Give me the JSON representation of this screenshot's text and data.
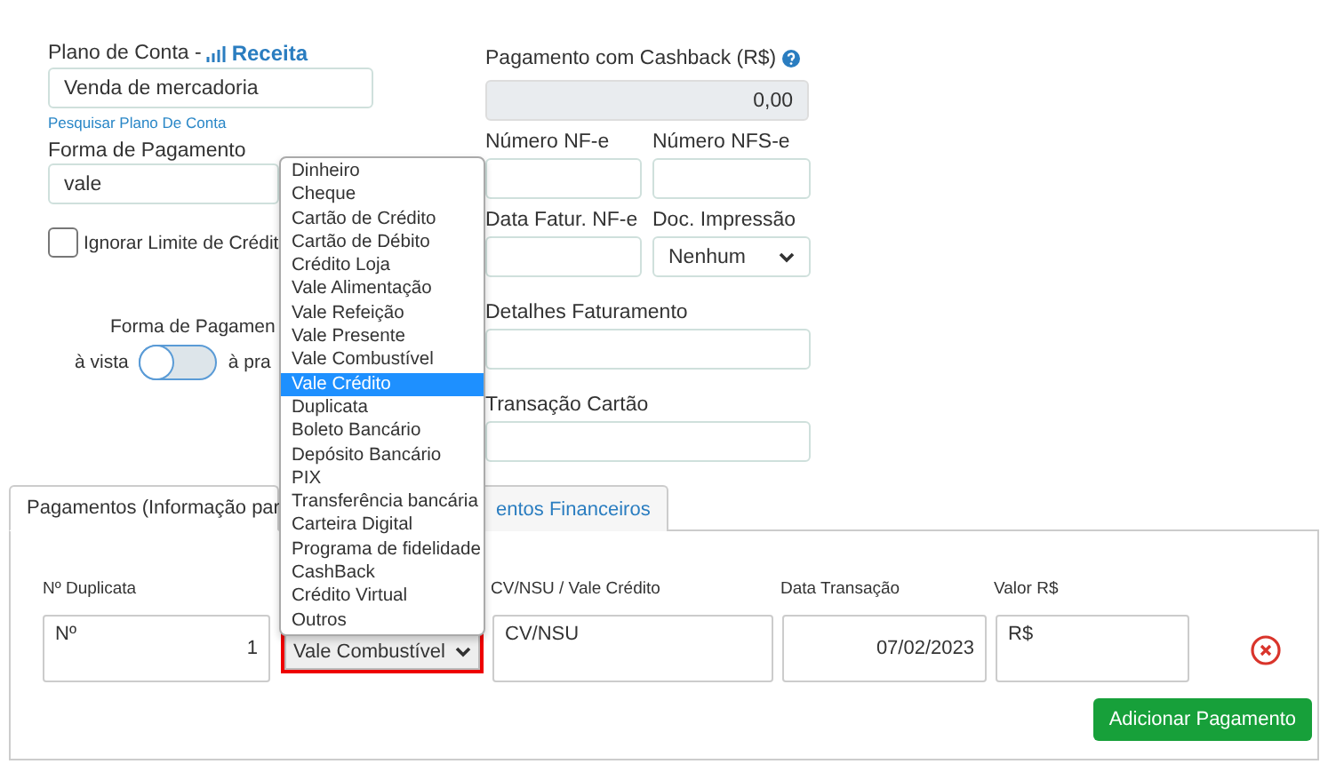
{
  "account_plan": {
    "label": "Plano de Conta -",
    "link": "Receita",
    "value": "Venda de mercadoria",
    "search_link": "Pesquisar Plano De Conta"
  },
  "payment_method": {
    "label": "Forma de Pagamento",
    "value": "vale"
  },
  "ignore_limit": {
    "label": "Ignorar Limite de Crédit",
    "checked": false
  },
  "payment_type": {
    "label": "Forma de Pagamen",
    "left": "à vista",
    "right": "à pra",
    "on": false
  },
  "cashback": {
    "label": "Pagamento com Cashback (R$)",
    "value": "0,00"
  },
  "invoice_fields": [
    {
      "label": "Número NF-e",
      "kind": "input"
    },
    {
      "label": "Número NFS-e",
      "kind": "input"
    },
    {
      "label": "Data Fatur. NF-e",
      "kind": "input"
    },
    {
      "label": "Doc. Impressão",
      "kind": "select",
      "value": "Nenhum"
    },
    {
      "label": "Detalhes Faturamento",
      "kind": "input"
    },
    {
      "label": "Transação Cartão",
      "kind": "input"
    }
  ],
  "tabs": [
    {
      "label": "Pagamentos (Informação par",
      "selected": true
    },
    {
      "label": "entos Financeiros",
      "selected": false
    }
  ],
  "payments": {
    "columns": [
      "Nº Duplicata",
      "CV/NSU / Vale Crédito",
      "Data Transação",
      "Valor R$"
    ],
    "row": {
      "number_prefix": "Nº",
      "number": "1",
      "method": "Vale Combustível",
      "cv": "CV/NSU",
      "date": "07/02/2023",
      "value_prefix": "R$"
    },
    "add_button": "Adicionar Pagamento"
  },
  "dropdown": {
    "options": [
      {
        "label": "Dinheiro",
        "selected": false
      },
      {
        "label": "Cheque",
        "selected": false
      },
      {
        "label": "Cartão de Crédito",
        "selected": false
      },
      {
        "label": "Cartão de Débito",
        "selected": false
      },
      {
        "label": "Crédito Loja",
        "selected": false
      },
      {
        "label": "Vale Alimentação",
        "selected": false
      },
      {
        "label": "Vale Refeição",
        "selected": false
      },
      {
        "label": "Vale Presente",
        "selected": false
      },
      {
        "label": "Vale Combustível",
        "selected": false
      },
      {
        "label": "Vale Crédito",
        "selected": true
      },
      {
        "label": "Duplicata",
        "selected": false
      },
      {
        "label": "Boleto Bancário",
        "selected": false
      },
      {
        "label": "Depósito Bancário",
        "selected": false
      },
      {
        "label": "PIX",
        "selected": false
      },
      {
        "label": "Transferência bancária",
        "selected": false
      },
      {
        "label": "Carteira Digital",
        "selected": false
      },
      {
        "label": "Programa de fidelidade",
        "selected": false
      },
      {
        "label": "CashBack",
        "selected": false
      },
      {
        "label": "Crédito Virtual",
        "selected": false
      },
      {
        "label": "Outros",
        "selected": false
      }
    ]
  }
}
